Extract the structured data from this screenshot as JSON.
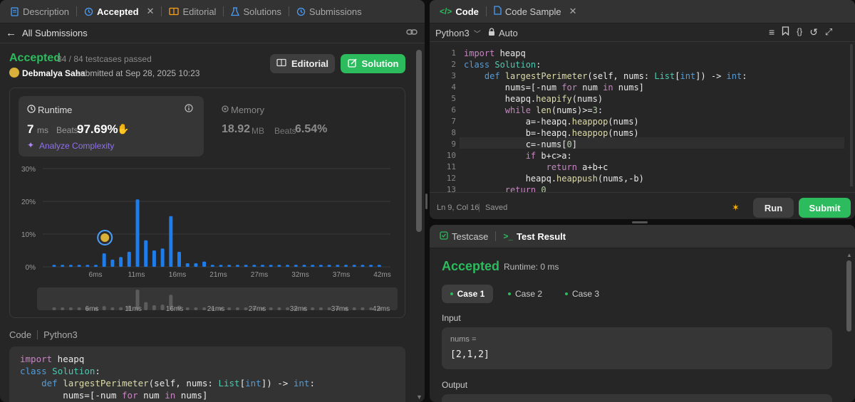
{
  "left_tabs": [
    {
      "label": "Description"
    },
    {
      "label": "Accepted"
    },
    {
      "label": "Editorial"
    },
    {
      "label": "Solutions"
    },
    {
      "label": "Submissions"
    }
  ],
  "back_label": "All Submissions",
  "result": {
    "status": "Accepted",
    "testcases": "84 / 84 testcases passed",
    "user": "Debmalya Saha",
    "submitted": "submitted at Sep 28, 2025 10:23",
    "editorial_btn": "Editorial",
    "solution_btn": "Solution"
  },
  "runtime": {
    "title": "Runtime",
    "value": "7",
    "unit": "ms",
    "beats_label": "Beats",
    "beats": "97.69%",
    "analyze": "Analyze Complexity"
  },
  "memory": {
    "title": "Memory",
    "value": "18.92",
    "unit": "MB",
    "beats_label": "Beats",
    "beats": "6.54%"
  },
  "chart_data": {
    "type": "bar",
    "y_ticks": [
      "30%",
      "20%",
      "10%",
      "0%"
    ],
    "ylim": [
      0,
      30
    ],
    "x_ticks": [
      "6ms",
      "11ms",
      "16ms",
      "21ms",
      "27ms",
      "32ms",
      "37ms",
      "42ms"
    ],
    "values": [
      0.6,
      0.6,
      0.6,
      0.6,
      0.6,
      0.6,
      4.1,
      2.2,
      3.0,
      4.6,
      20.6,
      8.1,
      5.0,
      5.6,
      15.5,
      4.6,
      1.1,
      1.1,
      1.6,
      0.6,
      0.6,
      0.6,
      0.6,
      0.6,
      0.6,
      0.6,
      0.6,
      0.6,
      0.6,
      0.6,
      0.6,
      0.6,
      0.6,
      0.6,
      0.6,
      0.6,
      0.6,
      0.6,
      0.6,
      0.6
    ],
    "highlight_index": 6
  },
  "code_header": {
    "label": "Code",
    "lang": "Python3"
  },
  "left_code": [
    "import heapq",
    "class Solution:",
    "    def largestPerimeter(self, nums: List[int]) -> int:",
    "        nums=[-num for num in nums]"
  ],
  "right_tabs": [
    {
      "label": "Code"
    },
    {
      "label": "Code Sample"
    }
  ],
  "editor": {
    "lang": "Python3",
    "mode": "Auto",
    "status": "Ln 9, Col 16",
    "saved": "Saved",
    "run": "Run",
    "submit": "Submit",
    "line_numbers": [
      "1",
      "2",
      "3",
      "4",
      "5",
      "6",
      "7",
      "8",
      "9",
      "10",
      "11",
      "12",
      "13"
    ]
  },
  "bottom_tabs": [
    {
      "label": "Testcase"
    },
    {
      "label": "Test Result"
    }
  ],
  "test_result": {
    "status": "Accepted",
    "runtime": "Runtime: 0 ms",
    "cases": [
      "Case 1",
      "Case 2",
      "Case 3"
    ],
    "input_label": "Input",
    "var_name": "nums =",
    "var_value": "[2,1,2]",
    "output_label": "Output"
  },
  "colors": {
    "accent_green": "#2cbb5d",
    "bar_blue": "#1f7ceb",
    "panel": "#262626"
  }
}
